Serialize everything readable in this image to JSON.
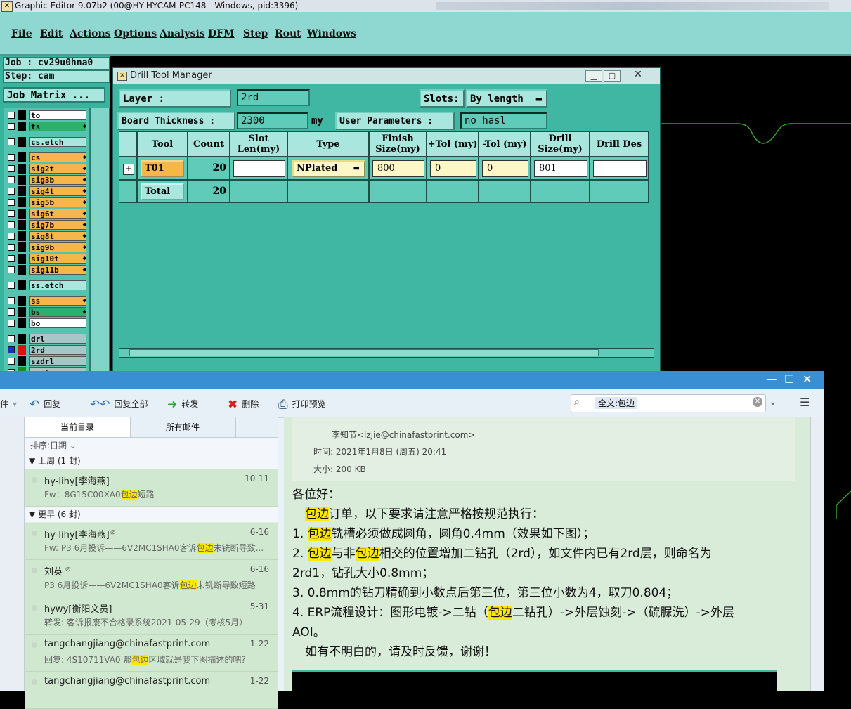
{
  "titlebar": {
    "title": "Graphic Editor 9.07b2 (00@HY-HYCAM-PC148 - Windows, pid:3396)"
  },
  "menu": [
    "File",
    "Edit",
    "Actions",
    "Options",
    "Analysis",
    "DFM",
    "Step",
    "Rout",
    "Windows"
  ],
  "left_panel": {
    "job": "Job : cv29u0hna0",
    "step": "Step: cam",
    "matrix_button": "Job Matrix ...",
    "layers": [
      {
        "name": "to",
        "style": "white"
      },
      {
        "name": "ts",
        "style": "green"
      },
      {
        "name": "cs.etch",
        "style": "teal"
      },
      {
        "name": "cs",
        "style": "orange"
      },
      {
        "name": "sig2t",
        "style": "orange"
      },
      {
        "name": "sig3b",
        "style": "orange"
      },
      {
        "name": "sig4t",
        "style": "orange"
      },
      {
        "name": "sig5b",
        "style": "orange"
      },
      {
        "name": "sig6t",
        "style": "orange"
      },
      {
        "name": "sig7b",
        "style": "orange"
      },
      {
        "name": "sig8t",
        "style": "orange"
      },
      {
        "name": "sig9b",
        "style": "orange"
      },
      {
        "name": "sig10t",
        "style": "orange"
      },
      {
        "name": "sig11b",
        "style": "orange"
      },
      {
        "name": "ss.etch",
        "style": "teal"
      },
      {
        "name": "ss",
        "style": "orange"
      },
      {
        "name": "bs",
        "style": "green"
      },
      {
        "name": "bo",
        "style": "white"
      },
      {
        "name": "drl",
        "style": "gray"
      },
      {
        "name": "2rd",
        "style": "gray"
      },
      {
        "name": "szdrl",
        "style": "gray"
      },
      {
        "name": "rout",
        "style": "gray"
      }
    ]
  },
  "drill_tool_manager": {
    "title": "Drill Tool Manager",
    "layer_label": "Layer         :",
    "layer_value": "2rd",
    "slots_label": "Slots:",
    "slots_value": "By length",
    "board_thickness_label": "Board Thickness :",
    "board_thickness_value": "2300",
    "unit": "my",
    "user_params_label": "User Parameters :",
    "user_params_value": "no_hasl",
    "columns": [
      "Tool",
      "Count",
      "Slot Len(my)",
      "Type",
      "Finish Size(my)",
      "+Tol (my)",
      "-Tol (my)",
      "Drill Size(my)",
      "Drill Des"
    ],
    "rows": [
      {
        "tool": "T01",
        "count": "20",
        "slot_len": "",
        "type": "NPlated",
        "finish": "800",
        "ptol": "0",
        "ntol": "0",
        "drill": "801",
        "des": ""
      },
      {
        "tool": "Total",
        "count": "20"
      }
    ]
  },
  "mail": {
    "toolbar": {
      "left_cut": "件",
      "reply": "回复",
      "reply_all": "回复全部",
      "forward": "转发",
      "delete": "删除",
      "print_preview": "打印预览",
      "search_label": "全文:包边"
    },
    "tabs": [
      "当前目录",
      "所有邮件"
    ],
    "sort_label": "排序:日期",
    "groups": [
      {
        "label": "上周 (1 封)"
      },
      {
        "label": "更早 (6 封)"
      }
    ],
    "items": [
      {
        "from": "hy-lihy[李海燕]",
        "date": "10-11",
        "subj_pre": "Fw：8G15C00XA0",
        "hl": "包边",
        "subj_post": "短路"
      },
      {
        "from": "hy-lihy[李海燕]",
        "date": "6-16",
        "subj_pre": "Fw: P3    6月投诉——6V2MC1SHA0客诉",
        "hl": "包边",
        "subj_post": "未铣断导致..."
      },
      {
        "from": "刘英",
        "date": "6-16",
        "subj_pre": "P3    6月投诉——6V2MC1SHA0客诉",
        "hl": "包边",
        "subj_post": "未铣断导致短路"
      },
      {
        "from": "hywy[衡阳文员]",
        "date": "5-31",
        "subj_pre": "转发: 客诉报废不合格录系统2021-05-29（考核5月）",
        "hl": "",
        "subj_post": ""
      },
      {
        "from": "tangchangjiang@chinafastprint.com",
        "date": "1-22",
        "subj_pre": "回复: 4S10711VA0 那",
        "hl": "包边",
        "subj_post": "区域就是我下图描述的吧？"
      },
      {
        "from": "tangchangjiang@chinafastprint.com",
        "date": "1-22",
        "subj_pre": "",
        "hl": "",
        "subj_post": ""
      }
    ],
    "header": {
      "cc_line": "李知节<lzjie@chinafastprint.com>",
      "time": "时间: 2021年1月8日 (周五) 20:41",
      "size": "大小: 200 KB"
    },
    "body": {
      "greeting": "各位好：",
      "l1_hl": "包边",
      "l1": "订单，以下要求请注意严格按规范执行：",
      "l2_pre": "1. ",
      "l2_hl": "包边",
      "l2": "铣槽必须做成圆角，圆角0.4mm（效果如下图）；",
      "l3_pre": "2. ",
      "l3_hl1": "包边",
      "l3_mid": "与非",
      "l3_hl2": "包边",
      "l3": "相交的位置增加二钻孔（2rd），如文件内已有2rd层，则命名为",
      "l4": "2rd1，钻孔大小0.8mm；",
      "l5": "3. 0.8mm的钻刀精确到小数点后第三位，第三位小数为4，取刀0.804；",
      "l6_pre": "4. ERP流程设计：图形电镀->二钻（",
      "l6_hl": "包边",
      "l6_post": "二钻孔）->外层蚀刻->（硫脲洗）->外层",
      "l7": "AOI。",
      "l8": "如有不明白的，请及时反馈，谢谢！"
    }
  }
}
